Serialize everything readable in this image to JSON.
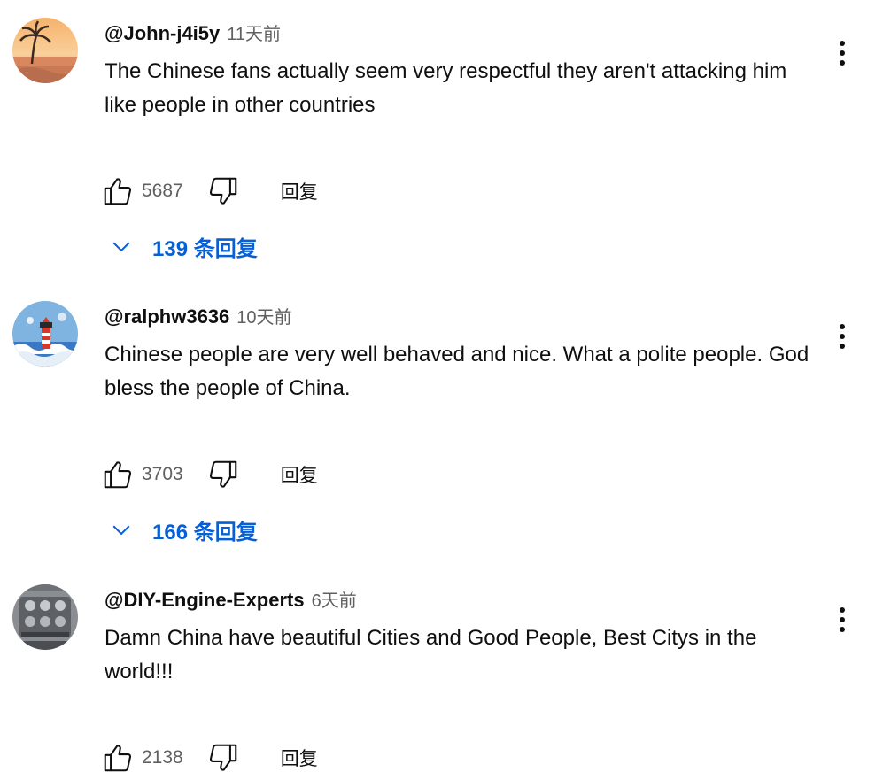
{
  "comments": [
    {
      "author": "@John-j4i5y",
      "time": "11天前",
      "text": "The Chinese fans actually seem very respectful they aren't attacking him like people in other countries",
      "likes": "5687",
      "reply_label": "回复",
      "replies_label": "139 条回复",
      "avatar_icon": "beach-sunset-avatar"
    },
    {
      "author": "@ralphw3636",
      "time": "10天前",
      "text": "Chinese people are very well behaved and nice. What a polite people. God bless the people of China.",
      "likes": "3703",
      "reply_label": "回复",
      "replies_label": "166 条回复",
      "avatar_icon": "lighthouse-avatar"
    },
    {
      "author": "@DIY-Engine-Experts",
      "time": "6天前",
      "text": "Damn China have beautiful Cities and Good People, Best Citys in the world!!!",
      "likes": "2138",
      "reply_label": "回复",
      "avatar_icon": "engine-avatar"
    }
  ],
  "colors": {
    "link_blue": "#065fd4",
    "meta_gray": "#606060",
    "text": "#0f0f0f"
  }
}
